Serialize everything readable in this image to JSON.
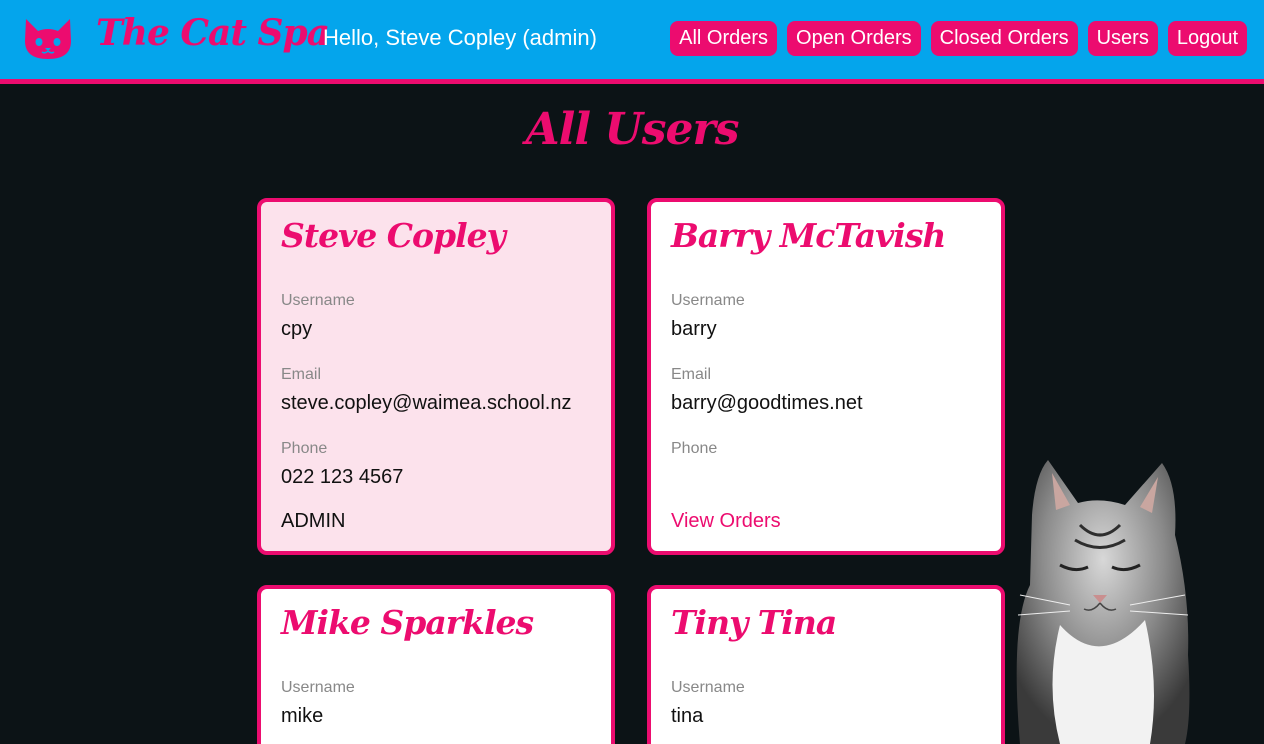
{
  "app": {
    "brand": "The Cat Spa",
    "greeting": "Hello, Steve Copley (admin)"
  },
  "nav": [
    "All Orders",
    "Open Orders",
    "Closed Orders",
    "Users",
    "Logout"
  ],
  "page": {
    "title": "All Users"
  },
  "labels": {
    "username": "Username",
    "email": "Email",
    "phone": "Phone",
    "view_orders": "View Orders"
  },
  "users": [
    {
      "name": "Steve Copley",
      "username": "cpy",
      "email": "steve.copley@waimea.school.nz",
      "phone": "022 123 4567",
      "role": "ADMIN"
    },
    {
      "name": "Barry McTavish",
      "username": "barry",
      "email": "barry@goodtimes.net",
      "phone": ""
    },
    {
      "name": "Mike Sparkles",
      "username": "mike"
    },
    {
      "name": "Tiny Tina",
      "username": "tina"
    }
  ],
  "colors": {
    "header_bg": "#04a5ec",
    "accent": "#ec0c6f",
    "page_bg": "#0c1316",
    "admin_card_bg": "#fce2ec"
  },
  "icons": {
    "logo": "cat-face-icon",
    "photo": "cat-photo"
  }
}
